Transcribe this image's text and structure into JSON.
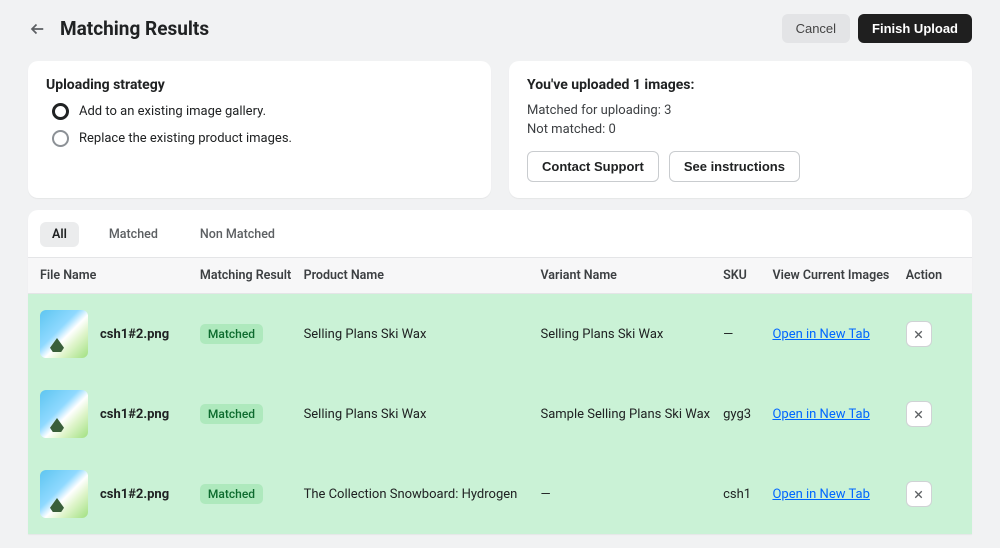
{
  "header": {
    "title": "Matching Results",
    "cancel": "Cancel",
    "finish": "Finish Upload"
  },
  "strategy": {
    "title": "Uploading strategy",
    "options": [
      {
        "label": "Add to an existing image gallery.",
        "selected": true
      },
      {
        "label": "Replace the existing product images.",
        "selected": false
      }
    ]
  },
  "summary": {
    "title": "You've uploaded 1 images:",
    "matched_line": "Matched for uploading: 3",
    "notmatched_line": "Not matched: 0",
    "contact": "Contact Support",
    "instructions": "See instructions"
  },
  "tabs": [
    "All",
    "Matched",
    "Non Matched"
  ],
  "active_tab": 0,
  "columns": {
    "file": "File Name",
    "match": "Matching Result",
    "product": "Product Name",
    "variant": "Variant Name",
    "sku": "SKU",
    "view": "View Current Images",
    "action": "Action"
  },
  "link_label": "Open in New Tab",
  "match_badge": "Matched",
  "rows": [
    {
      "file": "csh1#2.png",
      "product": "Selling Plans Ski Wax",
      "variant": "Selling Plans Ski Wax",
      "sku": "—"
    },
    {
      "file": "csh1#2.png",
      "product": "Selling Plans Ski Wax",
      "variant": "Sample Selling Plans Ski Wax",
      "sku": "gyg3"
    },
    {
      "file": "csh1#2.png",
      "product": "The Collection Snowboard: Hydrogen",
      "variant": "—",
      "sku": "csh1"
    }
  ]
}
